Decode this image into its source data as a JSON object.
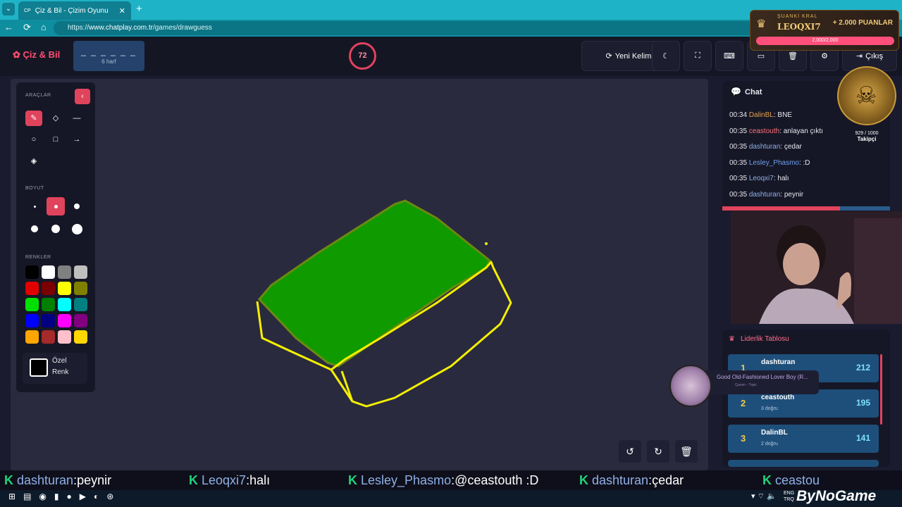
{
  "browser": {
    "tab_title": "Çiz & Bil - Çizim Oyunu",
    "tab_icon": "CP",
    "url_prefix": "https://",
    "url_domain": "www.chatplay.com.tr",
    "url_path": "/games/drawguess"
  },
  "header": {
    "logo": "Çiz & Bil",
    "word_mask": "_ _ _ _ _ _",
    "word_hint": "6 harf",
    "timer": "72",
    "new_word": "Yeni Kelime",
    "exit": "Çıkış"
  },
  "tools": {
    "section_tools": "ARAÇLAR",
    "section_size": "BOYUT",
    "section_colors": "RENKLER",
    "custom_color_line1": "Özel",
    "custom_color_line2": "Renk",
    "palette": [
      "#000000",
      "#ffffff",
      "#808080",
      "#bfbfbf",
      "#e00000",
      "#7a0000",
      "#ffff00",
      "#808000",
      "#00e000",
      "#008000",
      "#00ffff",
      "#008080",
      "#0000ff",
      "#000080",
      "#ff00ff",
      "#800080",
      "#ffa500",
      "#a52a2a",
      "#ffc0cb",
      "#ffd700"
    ]
  },
  "chat": {
    "title": "Chat",
    "messages": [
      {
        "time": "00:34",
        "user": "DalinBL",
        "user_color": "#e0a050",
        "text": ": BNE"
      },
      {
        "time": "00:35",
        "user": "ceastouth",
        "user_color": "#ff6f7a",
        "text": ": anlayan çıktı"
      },
      {
        "time": "00:35",
        "user": "dashturan",
        "user_color": "#8fb0e8",
        "text": ": çedar"
      },
      {
        "time": "00:35",
        "user": "Lesley_Phasmo",
        "user_color": "#6fa0f0",
        "text": ": :D"
      },
      {
        "time": "00:35",
        "user": "Leoqxi7",
        "user_color": "#8fb0e8",
        "text": ": halı"
      },
      {
        "time": "00:35",
        "user": "dashturan",
        "user_color": "#8fb0e8",
        "text": ": peynir"
      }
    ],
    "progress": 0.7
  },
  "leaderboard": {
    "title": "Liderlik Tablosu",
    "rows": [
      {
        "rank": "1",
        "name": "dashturan",
        "correct": "",
        "points": "212"
      },
      {
        "rank": "2",
        "name": "ceastouth",
        "correct": "3 doğru",
        "points": "195"
      },
      {
        "rank": "3",
        "name": "DalinBL",
        "correct": "2 doğru",
        "points": "141"
      }
    ]
  },
  "king": {
    "label": "ŞUANKİ KRAL",
    "name": "LEOQXI7",
    "points": "+ 2.000 PUANLAR",
    "progress": "2,000/2,000"
  },
  "followers": {
    "count": "929 / 1000",
    "label": "Takipçi"
  },
  "music": {
    "title": "Good Old-Fashioned Lover Boy (R...",
    "artist": "Queen - Topic"
  },
  "ticker": [
    {
      "user": "dashturan",
      "text": ":peynir"
    },
    {
      "user": "Leoqxi7",
      "text": ":halı"
    },
    {
      "user": "Lesley_Phasmo",
      "text": ":@ceastouth :D"
    },
    {
      "user": "dashturan",
      "text": ":çedar"
    },
    {
      "user": "ceastou",
      "text": ""
    }
  ],
  "brand": "ByNoGame",
  "tray": {
    "lang_1": "ENG",
    "lang_2": "TRQ"
  }
}
